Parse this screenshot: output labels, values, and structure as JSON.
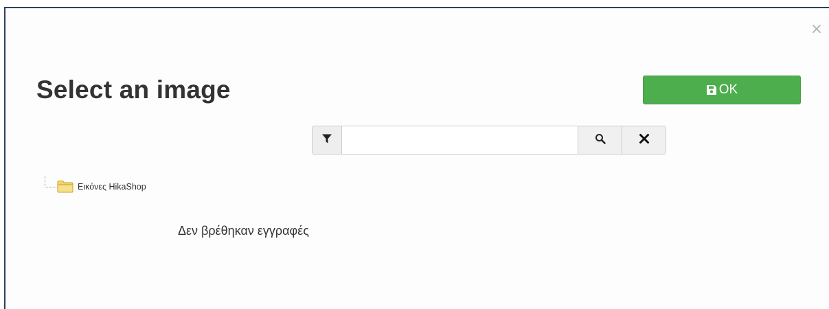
{
  "dialog": {
    "title": "Select an image",
    "close_glyph": "×",
    "ok_label": "OK",
    "ok_icon": "floppy-disk-icon",
    "ok_color": "#4cae4c"
  },
  "search": {
    "filter_icon": "funnel-icon",
    "value": "",
    "placeholder": "",
    "search_icon": "magnifier-icon",
    "clear_icon": "x-icon"
  },
  "tree": {
    "root_icon": "folder-icon",
    "root_label": "Εικόνες HikaShop"
  },
  "results": {
    "empty_message": "Δεν βρέθηκαν εγγραφές"
  }
}
